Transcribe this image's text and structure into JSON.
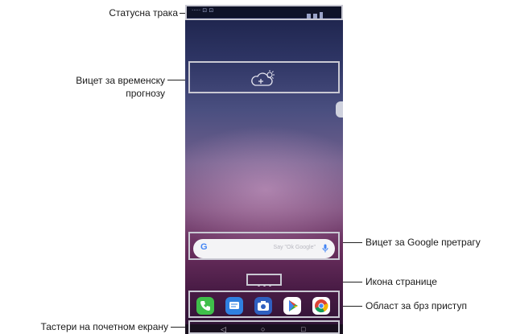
{
  "callouts": {
    "status_bar": "Статусна трака",
    "weather_widget_line1": "Вицет за временску",
    "weather_widget_line2": "прогнозу",
    "google_search_widget": "Вицет за Google претрагу",
    "page_icon": "Икона странице",
    "quick_access": "Област за брз приступ",
    "home_touch_buttons": "Тастери на почетном екрану"
  },
  "phone": {
    "status_left": "·····  ⊡ ⊡",
    "search": {
      "logo": "G",
      "hint": "Say \"Ok Google\""
    },
    "dock_apps": [
      "phone-app",
      "messages-app",
      "camera-app",
      "play-store-app",
      "chrome-app"
    ],
    "nav": {
      "back": "◁",
      "home": "○",
      "recents": "□"
    }
  },
  "colors": {
    "frame": "#c9c9d3",
    "phone_green": "#3fbf4a",
    "messages_blue": "#2f80e0",
    "camera_blue": "#2f5fc0"
  }
}
